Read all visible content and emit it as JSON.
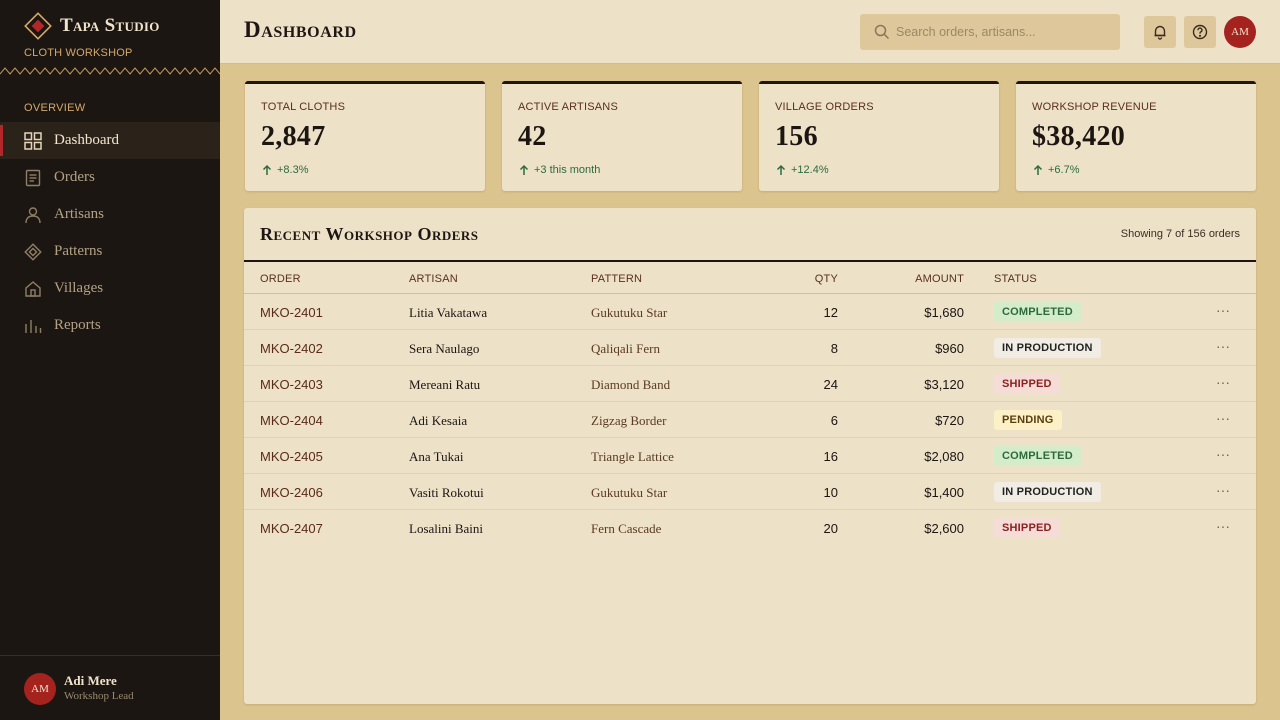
{
  "brand": {
    "title": "Tapa Studio",
    "subtitle": "CLOTH WORKSHOP"
  },
  "sidebar": {
    "section_label": "OVERVIEW",
    "items": [
      {
        "label": "Dashboard",
        "icon": "grid-icon",
        "active": true
      },
      {
        "label": "Orders",
        "icon": "document-icon"
      },
      {
        "label": "Artisans",
        "icon": "person-icon"
      },
      {
        "label": "Patterns",
        "icon": "diamond-icon"
      },
      {
        "label": "Villages",
        "icon": "house-icon"
      },
      {
        "label": "Reports",
        "icon": "bar-chart-icon"
      }
    ],
    "user": {
      "initials": "AM",
      "name": "Adi Mere",
      "role": "Workshop Lead"
    }
  },
  "header": {
    "title": "Dashboard",
    "search_placeholder": "Search orders, artisans...",
    "avatar_initials": "AM"
  },
  "stats": [
    {
      "label": "TOTAL CLOTHS",
      "value": "2,847",
      "delta": "+8.3%"
    },
    {
      "label": "ACTIVE ARTISANS",
      "value": "42",
      "delta": "+3 this month"
    },
    {
      "label": "VILLAGE ORDERS",
      "value": "156",
      "delta": "+12.4%"
    },
    {
      "label": "WORKSHOP REVENUE",
      "value": "$38,420",
      "delta": "+6.7%"
    }
  ],
  "orders": {
    "title": "Recent Workshop Orders",
    "count_text": "Showing 7 of 156 orders",
    "columns": {
      "order": "ORDER",
      "artisan": "ARTISAN",
      "pattern": "PATTERN",
      "qty": "QTY",
      "amount": "AMOUNT",
      "status": "STATUS"
    },
    "rows": [
      {
        "order": "MKO-2401",
        "artisan": "Litia Vakatawa",
        "pattern": "Gukutuku Star",
        "qty": "12",
        "amount": "$1,680",
        "status": "COMPLETED",
        "status_kind": "completed",
        "more": "···"
      },
      {
        "order": "MKO-2402",
        "artisan": "Sera Naulago",
        "pattern": "Qaliqali Fern",
        "qty": "8",
        "amount": "$960",
        "status": "IN PRODUCTION",
        "status_kind": "production",
        "more": "···"
      },
      {
        "order": "MKO-2403",
        "artisan": "Mereani Ratu",
        "pattern": "Diamond Band",
        "qty": "24",
        "amount": "$3,120",
        "status": "SHIPPED",
        "status_kind": "shipped",
        "more": "···"
      },
      {
        "order": "MKO-2404",
        "artisan": "Adi Kesaia",
        "pattern": "Zigzag Border",
        "qty": "6",
        "amount": "$720",
        "status": "PENDING",
        "status_kind": "pending",
        "more": "···"
      },
      {
        "order": "MKO-2405",
        "artisan": "Ana Tukai",
        "pattern": "Triangle Lattice",
        "qty": "16",
        "amount": "$2,080",
        "status": "COMPLETED",
        "status_kind": "completed",
        "more": "···"
      },
      {
        "order": "MKO-2406",
        "artisan": "Vasiti Rokotui",
        "pattern": "Gukutuku Star",
        "qty": "10",
        "amount": "$1,400",
        "status": "IN PRODUCTION",
        "status_kind": "production",
        "more": "···"
      },
      {
        "order": "MKO-2407",
        "artisan": "Losalini Baini",
        "pattern": "Fern Cascade",
        "qty": "20",
        "amount": "$2,600",
        "status": "SHIPPED",
        "status_kind": "shipped",
        "more": "···"
      }
    ]
  },
  "colors": {
    "sidebar_bg": "#1c1612",
    "accent_red": "#a4231f",
    "page_bg": "#dcc48e",
    "card_bg": "#ede1c8"
  }
}
